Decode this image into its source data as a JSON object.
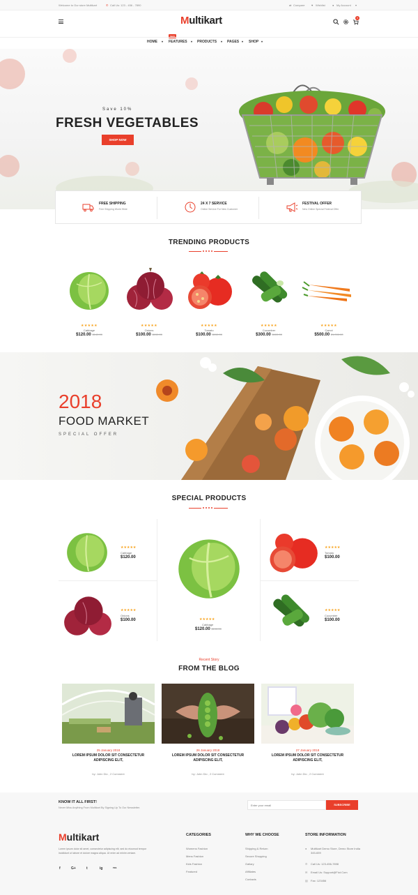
{
  "topbar": {
    "welcome": "Welcome to Our store Multikart",
    "phone": "Call Us: 123 - 456 - 7890",
    "compare": "Compare",
    "wishlist": "Wishlist",
    "account": "My Account"
  },
  "header": {
    "logo_m": "M",
    "logo_rest": "ultikart",
    "cart_count": "0",
    "nav": [
      "HOME",
      "FEATURES",
      "PRODUCTS",
      "PAGES",
      "SHOP"
    ],
    "new_badge": "NEW"
  },
  "hero": {
    "save": "Save 10%",
    "title": "FRESH VEGETABLES",
    "button": "SHOP NOW"
  },
  "services": [
    {
      "title": "FREE SHIPPING",
      "sub": "Free Shipping World Wide",
      "icon": "truck-icon"
    },
    {
      "title": "24 X 7 SERVICE",
      "sub": "Online Service For New Customer",
      "icon": "clock-icon"
    },
    {
      "title": "FESTIVAL OFFER",
      "sub": "New Online Special Festival Offer",
      "icon": "megaphone-icon"
    }
  ],
  "trending": {
    "title": "TRENDING PRODUCTS",
    "items": [
      {
        "name": "Cabbage",
        "price": "$120.00",
        "old": "$140.00",
        "stars": "★★★★★",
        "kind": "cabbage"
      },
      {
        "name": "Onions",
        "price": "$100.00",
        "old": "$150.00",
        "stars": "★★★★★",
        "kind": "onion"
      },
      {
        "name": "Tomato",
        "price": "$100.00",
        "old": "$150.00",
        "stars": "★★★★★",
        "kind": "tomato"
      },
      {
        "name": "Cucumber",
        "price": "$300.00",
        "old": "$400.00",
        "stars": "★★★★★",
        "kind": "cucumber"
      },
      {
        "name": "Carrot",
        "price": "$500.00",
        "old": "$1,000.00",
        "stars": "★★★★★",
        "kind": "carrot"
      }
    ]
  },
  "banner": {
    "year": "2018",
    "title": "FOOD MARKET",
    "sub": "SPECIAL OFFER"
  },
  "special": {
    "title": "SPECIAL PRODUCTS",
    "left": [
      {
        "name": "Cabbage",
        "price": "$120.00",
        "stars": "★★★★★"
      },
      {
        "name": "Onions",
        "price": "$100.00",
        "stars": "★★★★★"
      }
    ],
    "center": {
      "name": "Cabbage",
      "price": "$120.00",
      "old": "$190.00",
      "stars": "★★★★★"
    },
    "right": [
      {
        "name": "Tomato",
        "price": "$100.00",
        "stars": "★★★★★"
      },
      {
        "name": "Cucumber",
        "price": "$100.00",
        "stars": "★★★★★"
      }
    ]
  },
  "blog": {
    "kicker": "Recent Story",
    "title": "FROM THE BLOG",
    "posts": [
      {
        "date": "25 January 2018",
        "title": "LOREM IPSUM DOLOR SIT CONSECTETUR ADIPISCING ELIT,",
        "by": "by: John Dio , 2 Comment"
      },
      {
        "date": "26 January 2018",
        "title": "LOREM IPSUM DOLOR SIT CONSECTETUR ADIPISCING ELIT,",
        "by": "by: John Dio , 2 Comment"
      },
      {
        "date": "27 January 2018",
        "title": "LOREM IPSUM DOLOR SIT CONSECTETUR ADIPISCING ELIT,",
        "by": "by: John Dio , 2 Comment"
      }
    ]
  },
  "newsletter": {
    "title": "KNOW IT ALL FIRST!",
    "sub": "Never Miss Anything From Multikart By Signing Up To Our Newsletter.",
    "placeholder": "Enter your email",
    "button": "SUBSCRIBE"
  },
  "footer": {
    "logo_m": "M",
    "logo_rest": "ultikart",
    "about": "Lorem ipsum dolor sit amet, consectetur adipiscing elit, sed do eiusmod tempor incididunt ut labore et dolore magna aliqua. Ut enim ad minim veniam.",
    "social": [
      "f",
      "G+",
      "t",
      "ig",
      "rss"
    ],
    "col1": {
      "title": "CATEGORIES",
      "items": [
        "Womens Fashion",
        "Mens Fashion",
        "Kids Fashion",
        "Featured"
      ]
    },
    "col2": {
      "title": "WHY WE CHOOSE",
      "items": [
        "Shipping & Return",
        "Secure Shopping",
        "Gallary",
        "Affiliates",
        "Contacts"
      ]
    },
    "col3": {
      "title": "STORE INFORMATION",
      "items": [
        "Multikart Demo Store, Demo Store India 345-659",
        "Call Us: 123-456-7898",
        "Email Us: Support@Fiot.Com",
        "Fax: 123456"
      ]
    }
  },
  "colors": {
    "accent": "#e93f2b",
    "star": "#f8a31d"
  }
}
